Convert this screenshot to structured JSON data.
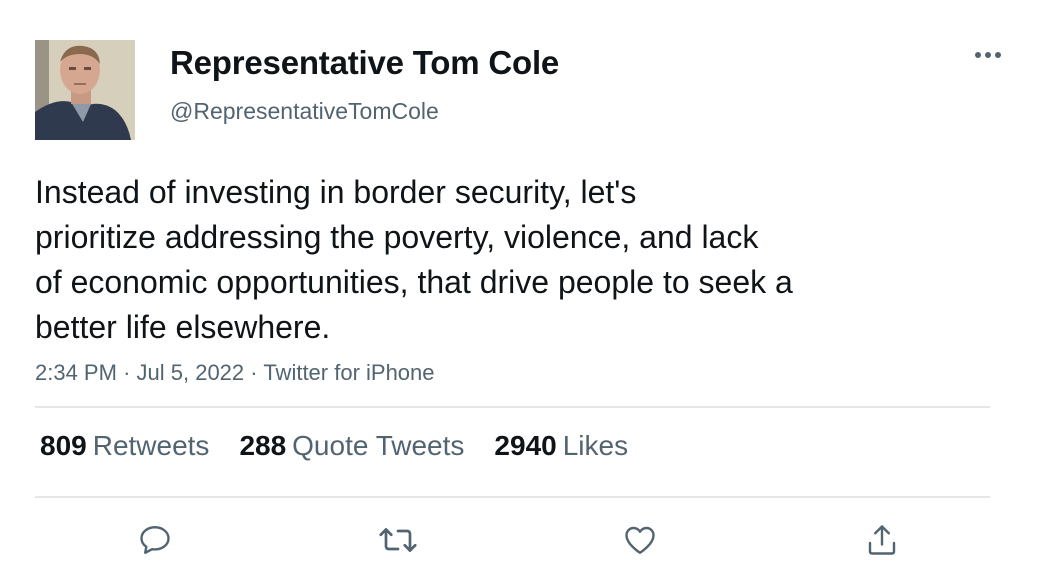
{
  "user": {
    "display_name": "Representative Tom Cole",
    "handle": "@RepresentativeTomCole"
  },
  "tweet": {
    "lines": [
      "Instead of investing in border security, let's",
      "prioritize addressing the poverty, violence, and lack",
      "of economic opportunities, that drive people to seek a",
      "better life elsewhere."
    ],
    "time": "2:34 PM",
    "date": "Jul 5, 2022",
    "source": "Twitter for iPhone",
    "separator": "·"
  },
  "stats": {
    "retweets": {
      "count": "809",
      "label": "Retweets"
    },
    "quote_tweets": {
      "count": "288",
      "label": "Quote Tweets"
    },
    "likes": {
      "count": "2940",
      "label": "Likes"
    }
  },
  "icons": {
    "more": "more-horizontal-icon",
    "reply": "reply-icon",
    "retweet": "retweet-icon",
    "like": "heart-icon",
    "share": "share-icon"
  },
  "colors": {
    "text": "#0f1419",
    "secondary": "#536471",
    "divider": "#e6e6e6"
  }
}
